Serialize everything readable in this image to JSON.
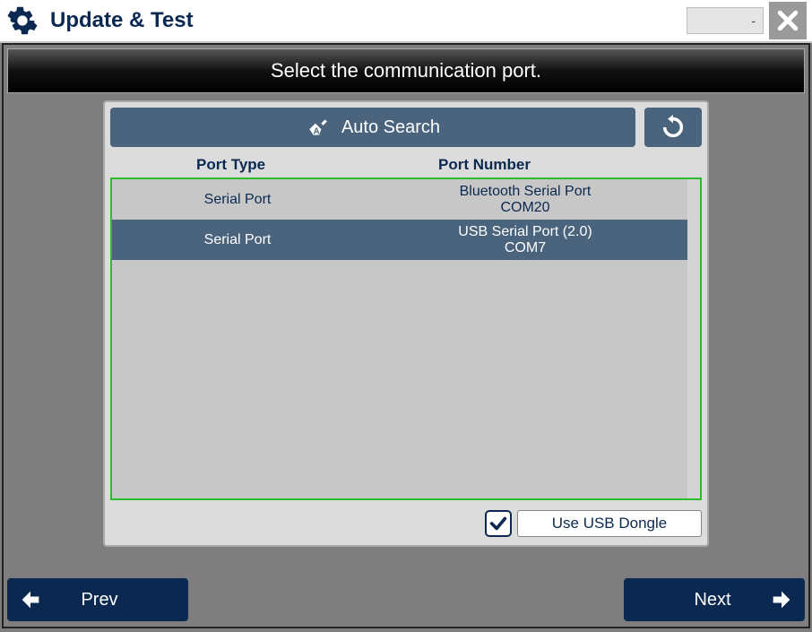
{
  "titlebar": {
    "title": "Update & Test",
    "dropdown_value": "-"
  },
  "banner": "Select the communication port.",
  "search": {
    "auto_search_label": "Auto Search"
  },
  "table": {
    "header_type": "Port Type",
    "header_number": "Port Number",
    "rows": [
      {
        "type": "Serial Port",
        "name": "Bluetooth Serial Port",
        "com": "COM20",
        "selected": false
      },
      {
        "type": "Serial Port",
        "name": "USB Serial Port (2.0)",
        "com": "COM7",
        "selected": true
      }
    ]
  },
  "dongle": {
    "checked": true,
    "label": "Use USB Dongle"
  },
  "nav": {
    "prev": "Prev",
    "next": "Next"
  }
}
